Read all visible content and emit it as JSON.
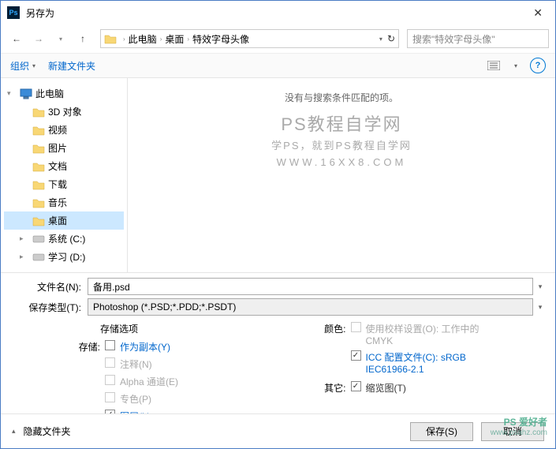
{
  "titlebar": {
    "title": "另存为"
  },
  "breadcrumbs": {
    "b0": "此电脑",
    "b1": "桌面",
    "b2": "特效字母头像"
  },
  "search": {
    "placeholder": "搜索\"特效字母头像\""
  },
  "toolbar": {
    "organize": "组织",
    "newfolder": "新建文件夹"
  },
  "tree": {
    "thispc": "此电脑",
    "objects3d": "3D 对象",
    "videos": "视频",
    "pictures": "图片",
    "documents": "文档",
    "downloads": "下载",
    "music": "音乐",
    "desktop": "桌面",
    "sysc": "系统 (C:)",
    "studyd": "学习 (D:)"
  },
  "content": {
    "empty": "没有与搜索条件匹配的项。",
    "wm1": "PS教程自学网",
    "wm2": "学PS，就到PS教程自学网",
    "wm3": "WWW.16XX8.COM"
  },
  "fields": {
    "filename_label": "文件名(N):",
    "filename_value": "备用.psd",
    "type_label": "保存类型(T):",
    "type_value": "Photoshop (*.PSD;*.PDD;*.PSDT)"
  },
  "options": {
    "header": "存储选项",
    "save_label": "存储:",
    "as_copy": "作为副本(Y)",
    "notes": "注释(N)",
    "alpha": "Alpha 通道(E)",
    "spot": "专色(P)",
    "layers": "图层(L)",
    "color_label": "颜色:",
    "proof": "使用校样设置(O): 工作中的 CMYK",
    "icc": "ICC 配置文件(C): sRGB IEC61966-2.1",
    "other_label": "其它:",
    "thumbnail": "缩览图(T)"
  },
  "footer": {
    "hide": "隐藏文件夹",
    "save": "保存(S)",
    "cancel": "取消"
  },
  "corner": {
    "brand": "PS 爱好者",
    "url": "www.psahz.com"
  }
}
